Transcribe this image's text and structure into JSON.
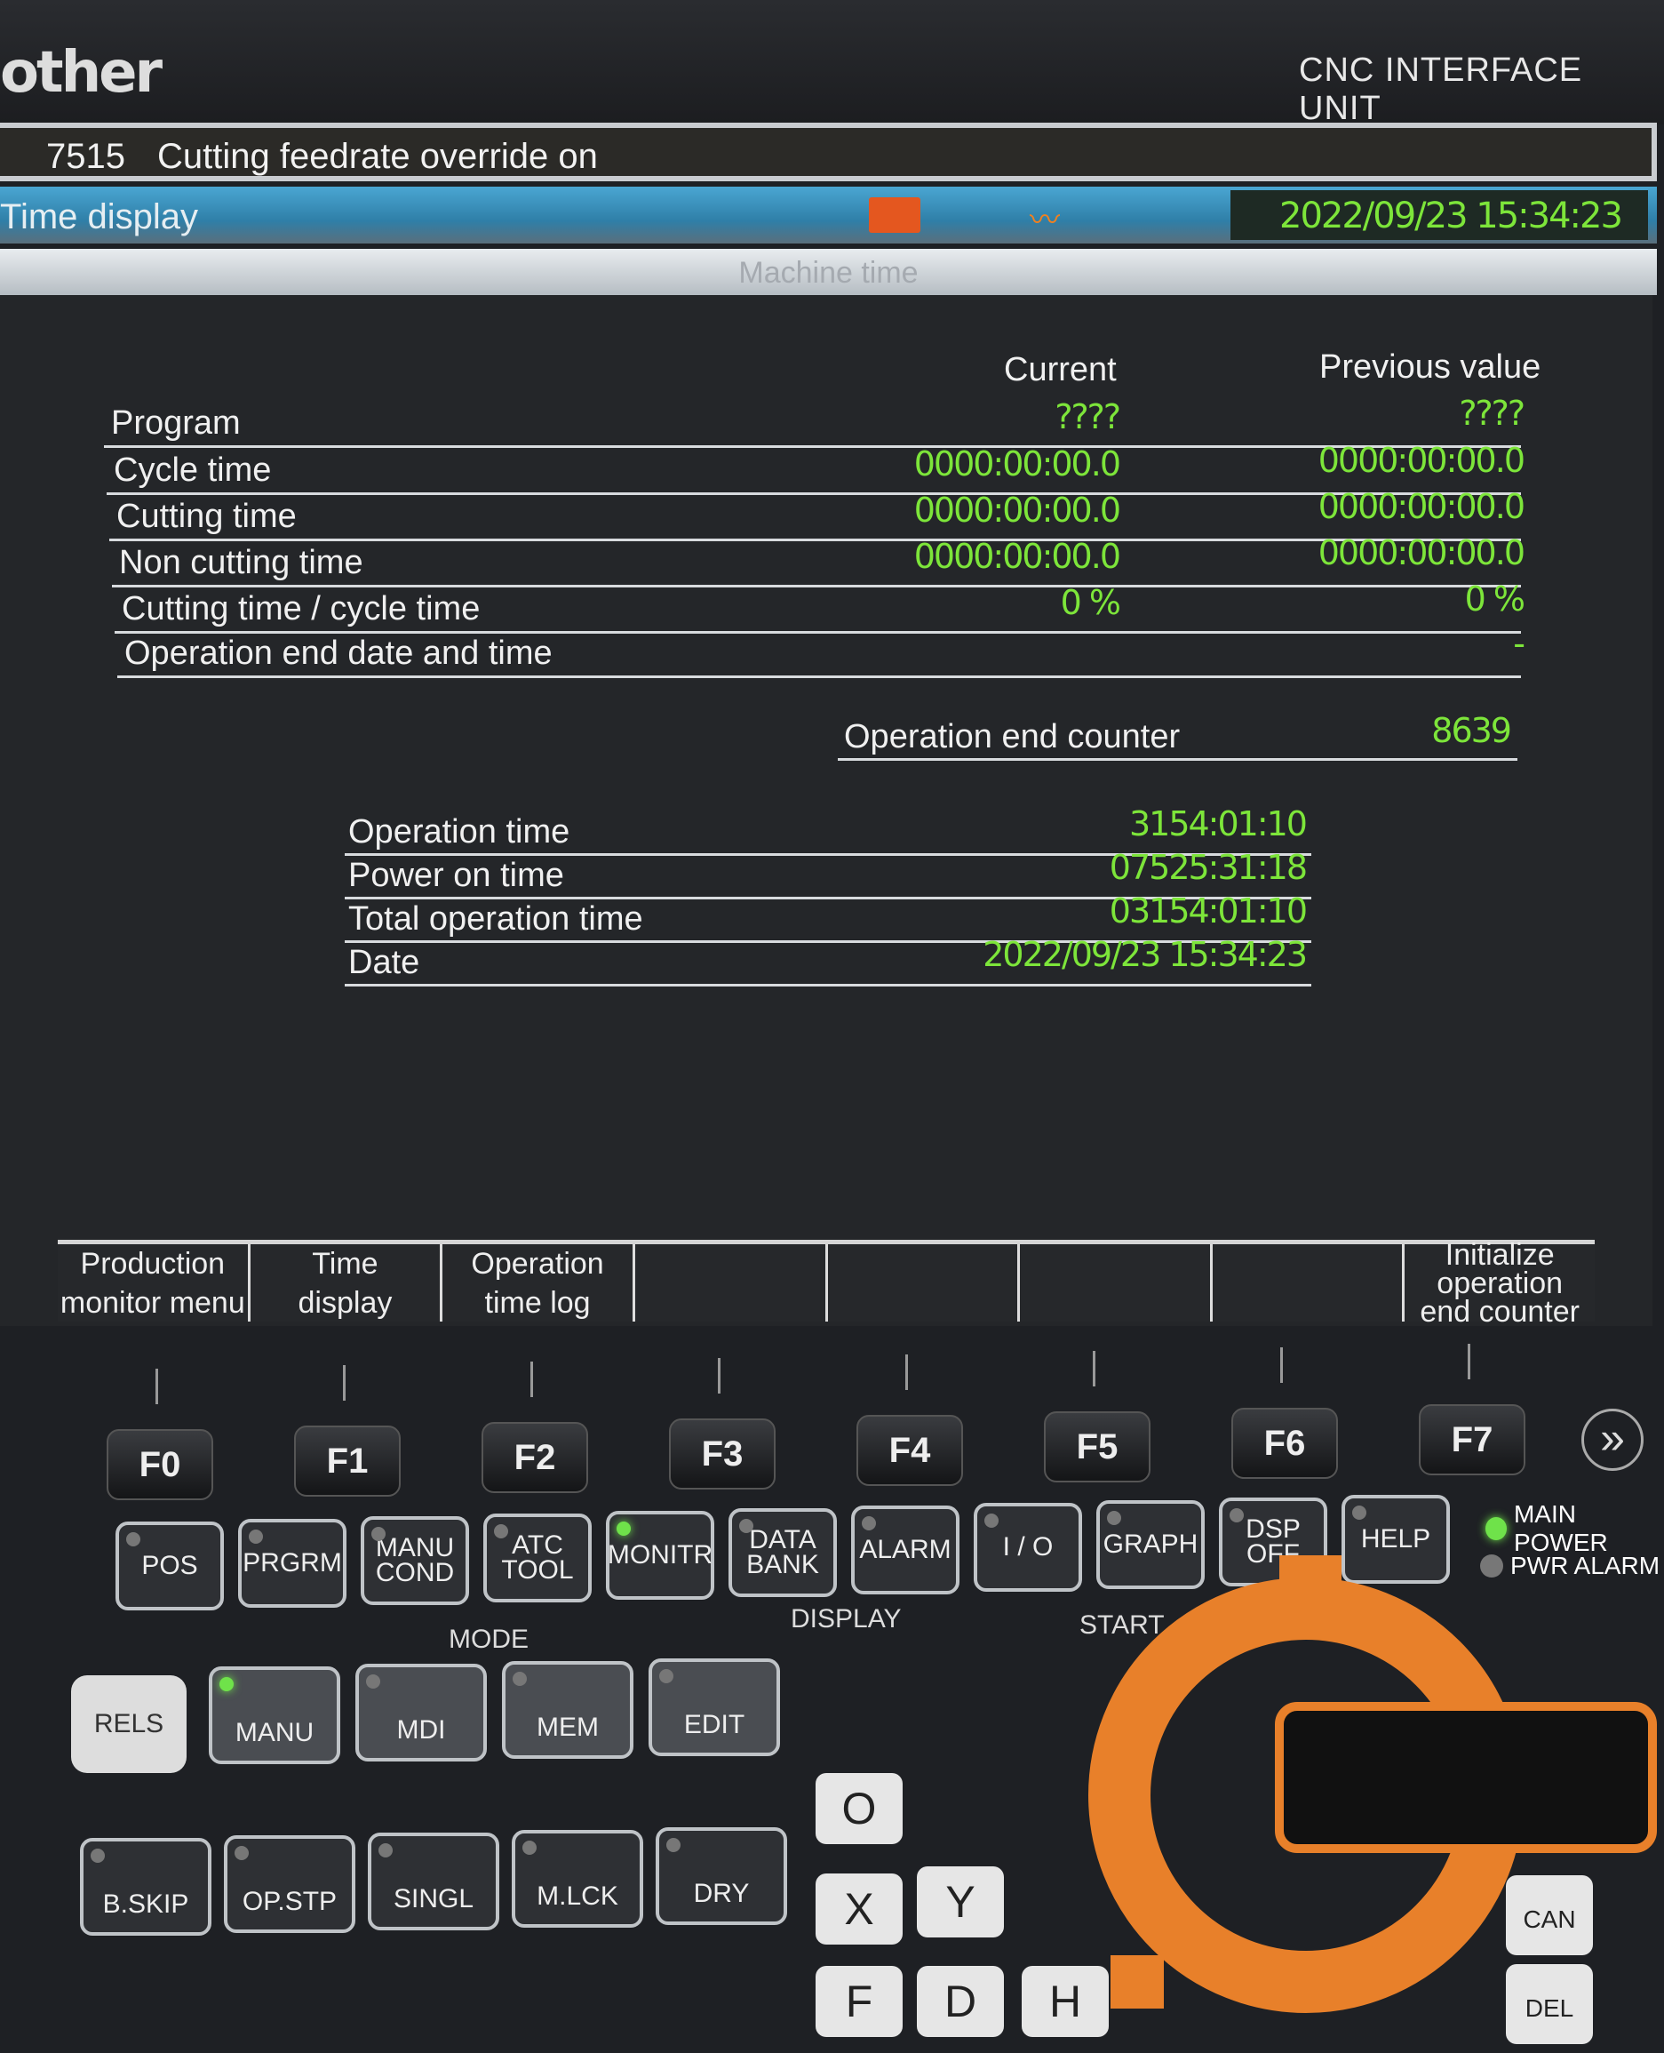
{
  "header": {
    "brand": "other",
    "unit": "CNC INTERFACE UNIT"
  },
  "message": {
    "code": "7515",
    "text": "Cutting feedrate override on"
  },
  "titlebar": {
    "title": "Time display",
    "datetime": "2022/09/23 15:34:23",
    "icons": [
      "spindle-status-icon",
      "waveform-icon"
    ]
  },
  "subbar": {
    "text": "Machine time"
  },
  "machine_time": {
    "headers": {
      "current": "Current",
      "previous": "Previous value"
    },
    "rows": [
      {
        "label": "Program",
        "current": "????",
        "previous": "????"
      },
      {
        "label": "Cycle time",
        "current": "0000:00:00.0",
        "previous": "0000:00:00.0"
      },
      {
        "label": "Cutting time",
        "current": "0000:00:00.0",
        "previous": "0000:00:00.0"
      },
      {
        "label": "Non cutting time",
        "current": "0000:00:00.0",
        "previous": "0000:00:00.0"
      },
      {
        "label": "Cutting time / cycle time",
        "current": "0 %",
        "previous": "0 %"
      },
      {
        "label": "Operation end date and time",
        "current": "",
        "previous": "-"
      }
    ],
    "counter": {
      "label": "Operation end counter",
      "value": "8639"
    }
  },
  "totals": [
    {
      "label": "Operation time",
      "value": "3154:01:10"
    },
    {
      "label": "Power on time",
      "value": "07525:31:18"
    },
    {
      "label": "Total operation time",
      "value": "03154:01:10"
    },
    {
      "label": "Date",
      "value": "2022/09/23 15:34:23"
    }
  ],
  "softkeys": [
    "Production\nmonitor menu",
    "Time\ndisplay",
    "Operation\ntime log",
    "",
    "",
    "",
    "",
    "Initialize\noperation\nend counter"
  ],
  "fkeys": [
    "F0",
    "F1",
    "F2",
    "F3",
    "F4",
    "F5",
    "F6",
    "F7"
  ],
  "display_keys": [
    "POS",
    "PRGRM",
    "MANU\nCOND",
    "ATC\nTOOL",
    "MONITR",
    "DATA\nBANK",
    "ALARM",
    "I / O",
    "GRAPH",
    "DSP\nOFF",
    "HELP"
  ],
  "indicators": {
    "main_power": "MAIN POWER",
    "pwr_alarm": "PWR ALARM"
  },
  "sections": {
    "mode": "MODE",
    "display": "DISPLAY",
    "start": "START"
  },
  "mode_keys": [
    "RELS",
    "MANU",
    "MDI",
    "MEM",
    "EDIT"
  ],
  "func_keys": [
    "B.SKIP",
    "OP.STP",
    "SINGL",
    "M.LCK",
    "DRY"
  ],
  "letter_keys": [
    "O",
    "X",
    "Y",
    "F",
    "D",
    "H"
  ],
  "side_keys": [
    "CAN",
    "DEL"
  ],
  "colors": {
    "green_value": "#7de53a",
    "title_blue": "#3a90bd",
    "watermark": "#e8802a"
  }
}
